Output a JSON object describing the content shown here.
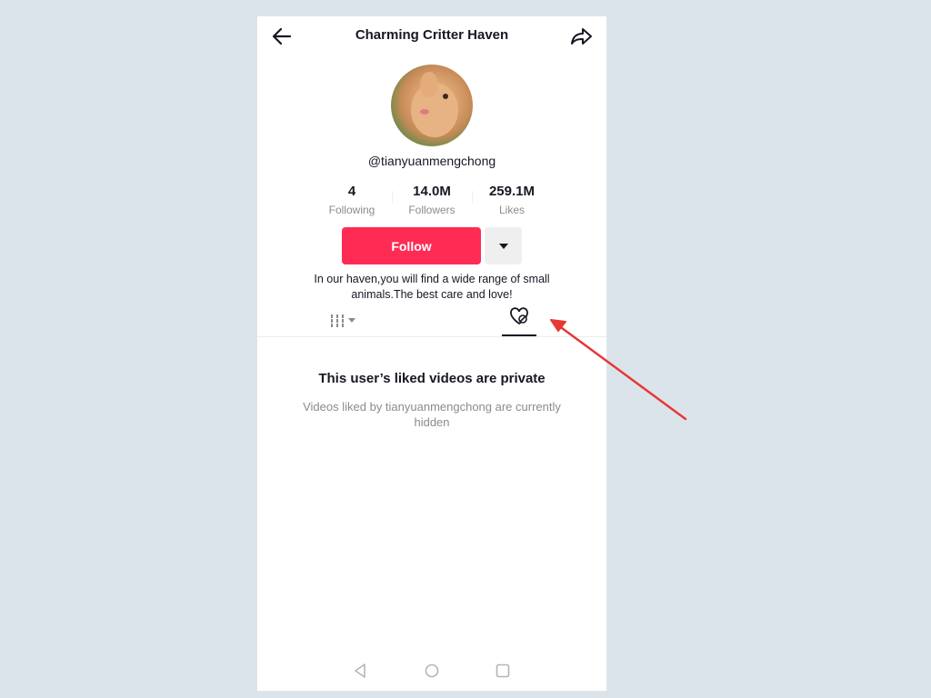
{
  "header": {
    "title": "Charming Critter Haven"
  },
  "profile": {
    "handle": "@tianyuanmengchong",
    "stats": [
      {
        "value": "4",
        "label": "Following"
      },
      {
        "value": "14.0M",
        "label": "Followers"
      },
      {
        "value": "259.1M",
        "label": "Likes"
      }
    ],
    "follow_label": "Follow",
    "bio": "In our haven,you will find a wide range of small animals.The best care and love!"
  },
  "tabs": [
    {
      "name": "videos",
      "icon": "grid-icon",
      "active": false
    },
    {
      "name": "liked",
      "icon": "hidden-heart-icon",
      "active": true
    }
  ],
  "liked_private": {
    "title": "This user’s liked videos are private",
    "subtitle": "Videos liked by tianyuanmengchong are currently hidden"
  },
  "colors": {
    "accent": "#fe2c55",
    "annotation_arrow": "#e53935"
  }
}
